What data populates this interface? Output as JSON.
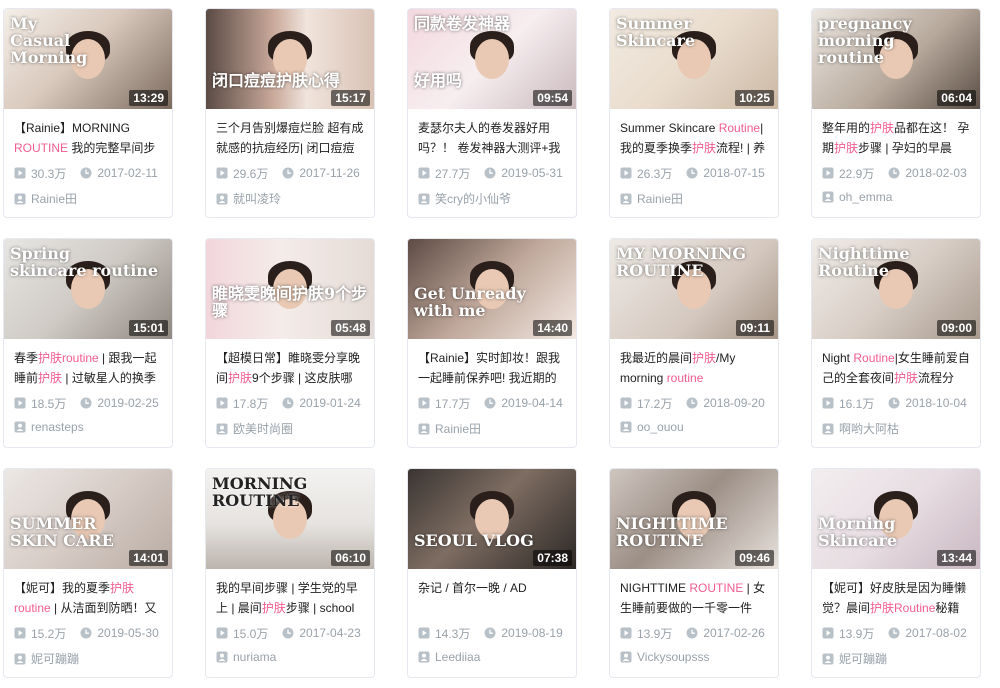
{
  "colors": {
    "highlight": "#f25d8e",
    "meta": "#99a2aa",
    "border": "#e5e9ef"
  },
  "icons": {
    "play": "play-count-icon",
    "clock": "clock-icon",
    "user": "uploader-icon"
  },
  "videos": [
    {
      "thumb_text": "My\nCasual\nMorning",
      "thumb_text2": "",
      "duration": "13:29",
      "title": [
        [
          "【Rainie】MORNING ",
          false
        ],
        [
          "ROUTINE",
          true
        ],
        [
          " 我的完整早间步",
          false
        ]
      ],
      "views": "30.3万",
      "date": "2017-02-11",
      "uploader": "Rainie田"
    },
    {
      "thumb_text": "",
      "thumb_text2": "闭口痘痘护肤心得",
      "duration": "15:17",
      "title": [
        [
          "三个月告别爆痘烂脸 超有成就感的抗痘经历| 闭口痘痘",
          false
        ]
      ],
      "views": "29.6万",
      "date": "2017-11-26",
      "uploader": "就叫凌玲"
    },
    {
      "thumb_text": "同款卷发神器",
      "thumb_text2": "好用吗",
      "duration": "09:54",
      "title": [
        [
          "麦瑟尔夫人的卷发器好用吗？！ 卷发神器大测评+我",
          false
        ]
      ],
      "views": "27.7万",
      "date": "2019-05-31",
      "uploader": "笑cry的小仙爷"
    },
    {
      "thumb_text": "Summer\nSkincare",
      "thumb_text2": "",
      "duration": "10:25",
      "title": [
        [
          "Summer Skincare ",
          false
        ],
        [
          "Routine",
          true
        ],
        [
          "| 我的夏季换季",
          false
        ],
        [
          "护肤",
          true
        ],
        [
          "流程! | 养",
          false
        ]
      ],
      "views": "26.3万",
      "date": "2018-07-15",
      "uploader": "Rainie田"
    },
    {
      "thumb_text": "pregnancy\nmorning\nroutine",
      "thumb_text2": "",
      "duration": "06:04",
      "title": [
        [
          "整年用的",
          false
        ],
        [
          "护肤",
          true
        ],
        [
          "品都在这！ 孕期",
          false
        ],
        [
          "护肤",
          true
        ],
        [
          "步骤 | 孕妇的早晨",
          false
        ]
      ],
      "views": "22.9万",
      "date": "2018-02-03",
      "uploader": "oh_emma"
    },
    {
      "thumb_text": "Spring\nskincare routine",
      "thumb_text2": "",
      "duration": "15:01",
      "title": [
        [
          "春季",
          false
        ],
        [
          "护肤routine",
          true
        ],
        [
          " | 跟我一起睡前",
          false
        ],
        [
          "护肤",
          true
        ],
        [
          " | 过敏星人的换季",
          false
        ]
      ],
      "views": "18.5万",
      "date": "2019-02-25",
      "uploader": "renasteps"
    },
    {
      "thumb_text": "",
      "thumb_text2": "睢晓雯晚间护肤9个步骤",
      "duration": "05:48",
      "title": [
        [
          "【超模日常】睢晓雯分享晚间",
          false
        ],
        [
          "护肤",
          true
        ],
        [
          "9个步骤 | 这皮肤哪",
          false
        ]
      ],
      "views": "17.8万",
      "date": "2019-01-24",
      "uploader": "欧美时尚圈"
    },
    {
      "thumb_text": "",
      "thumb_text2": "Get Unready\nwith me",
      "duration": "14:40",
      "title": [
        [
          "【Rainie】实时卸妆！跟我一起睡前保养吧! 我近期的",
          false
        ]
      ],
      "views": "17.7万",
      "date": "2019-04-14",
      "uploader": "Rainie田"
    },
    {
      "thumb_text": "MY MORNING ROUTINE",
      "thumb_text2": "",
      "duration": "09:11",
      "title": [
        [
          "我最近的晨间",
          false
        ],
        [
          "护肤",
          true
        ],
        [
          "/My morning ",
          false
        ],
        [
          "routine",
          true
        ]
      ],
      "views": "17.2万",
      "date": "2018-09-20",
      "uploader": "oo_ouou"
    },
    {
      "thumb_text": "Nighttime\nRoutine",
      "thumb_text2": "",
      "duration": "09:00",
      "title": [
        [
          "Night ",
          false
        ],
        [
          "Routine",
          true
        ],
        [
          "|女生睡前爱自己的全套夜间",
          false
        ],
        [
          "护肤",
          true
        ],
        [
          "流程分",
          false
        ]
      ],
      "views": "16.1万",
      "date": "2018-10-04",
      "uploader": "啊哟大阿枯"
    },
    {
      "thumb_text": "",
      "thumb_text2": "SUMMER\nSKIN CARE",
      "duration": "14:01",
      "title": [
        [
          "【妮可】我的夏季",
          false
        ],
        [
          "护肤",
          true
        ],
        [
          " ",
          false
        ],
        [
          "routine",
          true
        ],
        [
          " | 从洁面到防晒！又",
          false
        ]
      ],
      "views": "15.2万",
      "date": "2019-05-30",
      "uploader": "妮可蹦蹦"
    },
    {
      "thumb_text": "MORNING    ROUTINE",
      "thumb_text2": "",
      "duration": "06:10",
      "title": [
        [
          "我的早间步骤 | 学生党的早上 | 晨间",
          false
        ],
        [
          "护肤",
          true
        ],
        [
          "步骤 | school",
          false
        ]
      ],
      "views": "15.0万",
      "date": "2017-04-23",
      "uploader": "nuriama"
    },
    {
      "thumb_text": "",
      "thumb_text2": "SEOUL VLOG",
      "duration": "07:38",
      "title": [
        [
          "杂记 / 首尔一晚 / AD",
          false
        ]
      ],
      "views": "14.3万",
      "date": "2019-08-19",
      "uploader": "Leediiaa"
    },
    {
      "thumb_text": "",
      "thumb_text2": "NIGHTTIME\nROUTINE",
      "duration": "09:46",
      "title": [
        [
          "NIGHTTIME ",
          false
        ],
        [
          "ROUTINE",
          true
        ],
        [
          " | 女生睡前要做的一千零一件",
          false
        ]
      ],
      "views": "13.9万",
      "date": "2017-02-26",
      "uploader": "Vickysoupsss"
    },
    {
      "thumb_text": "",
      "thumb_text2": "Morning\nSkincare",
      "duration": "13:44",
      "title": [
        [
          "【妮可】好皮肤是因为睡懒觉？晨间",
          false
        ],
        [
          "护肤Routine",
          true
        ],
        [
          "秘籍",
          false
        ]
      ],
      "views": "13.9万",
      "date": "2017-08-02",
      "uploader": "妮可蹦蹦"
    }
  ]
}
